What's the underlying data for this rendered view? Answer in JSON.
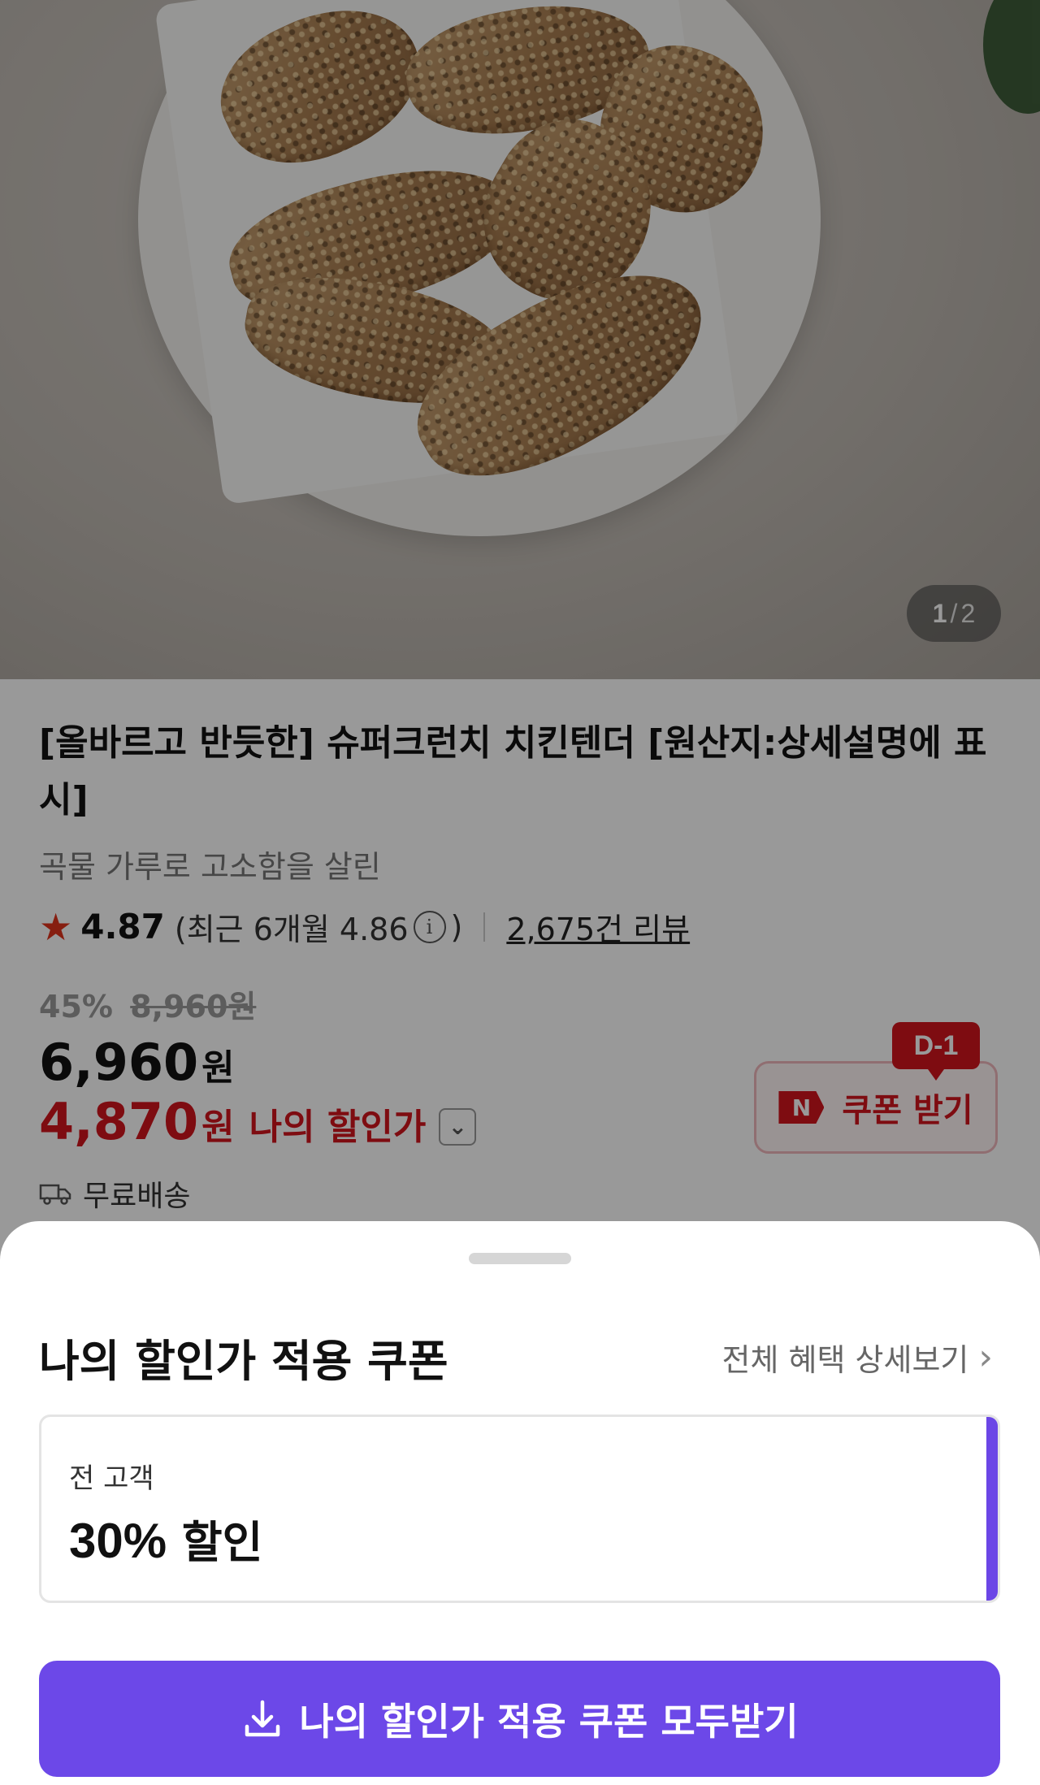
{
  "product": {
    "image_counter": {
      "current": "1",
      "separator": "/",
      "total": "2"
    },
    "title": "[올바르고 반듯한] 슈퍼크런치 치킨텐더 [원산지:상세설명에 표시]",
    "subtitle": "곡물 가루로 고소함을 살린",
    "rating": {
      "score": "4.87",
      "recent_open": "(최근 6개월 4.86",
      "info_icon_glyph": "i",
      "recent_close": ")",
      "reviews_link": "2,675건 리뷰"
    },
    "pricing": {
      "discount_rate": "45%",
      "original_price": "8,960원",
      "sale_price": "6,960",
      "sale_currency": "원",
      "my_price": "4,870",
      "my_currency": "원",
      "my_price_label": "나의 할인가",
      "chevron_glyph": "⌄"
    },
    "shipping": "무료배송",
    "coupon_button": {
      "badge": "D-1",
      "n_icon": "N",
      "label": "쿠폰 받기"
    }
  },
  "sheet": {
    "title": "나의 할인가 적용 쿠폰",
    "detail_link": "전체 혜택 상세보기",
    "detail_chevron": "›",
    "coupon": {
      "target": "전 고객",
      "percent": "30%",
      "suffix": "할인",
      "accent_color": "#6b46e6"
    },
    "download_all_label": "나의 할인가 적용 쿠폰 모두받기"
  },
  "colors": {
    "brand_red": "#d3141d",
    "brand_purple": "#6c48e8"
  }
}
